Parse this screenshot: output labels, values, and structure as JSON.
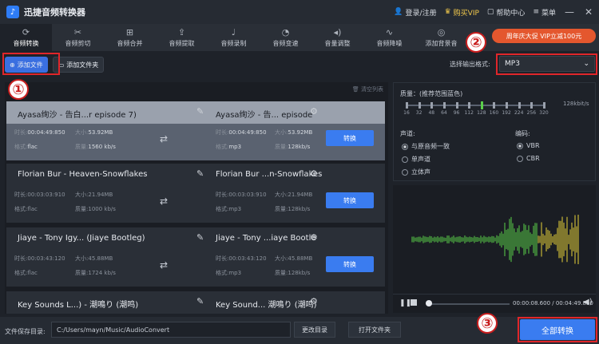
{
  "app": {
    "title": "迅捷音频转换器"
  },
  "titlebar": {
    "login": "登录/注册",
    "vip": "购买VIP",
    "help": "帮助中心",
    "menu": "菜单",
    "minimize": "—",
    "close": "✕"
  },
  "toolbar": {
    "tabs": [
      {
        "label": "音频转换",
        "icon": "refresh-icon"
      },
      {
        "label": "音频剪切",
        "icon": "scissors-icon"
      },
      {
        "label": "音频合并",
        "icon": "merge-icon"
      },
      {
        "label": "音频提取",
        "icon": "extract-icon"
      },
      {
        "label": "音频录制",
        "icon": "microphone-icon"
      },
      {
        "label": "音频变速",
        "icon": "speed-icon"
      },
      {
        "label": "音量调整",
        "icon": "volume-icon"
      },
      {
        "label": "音频降噪",
        "icon": "denoise-icon"
      },
      {
        "label": "添加背景音",
        "icon": "music-icon"
      }
    ],
    "promo": "周年庆大促 VIP立减100元"
  },
  "actions": {
    "add_file": "添加文件",
    "add_folder": "添加文件夹",
    "format_label": "选择输出格式:",
    "format_value": "MP3"
  },
  "annotations": {
    "one": "①",
    "two": "②",
    "three": "③"
  },
  "filelist": {
    "clear": "清空列表",
    "items": [
      {
        "src": "Ayasa绚沙 - 告白...r episode 7)",
        "dst": "Ayasa绚沙 - 告... episode",
        "src_duration": "00:04:49:850",
        "src_size": "53.92MB",
        "src_format": "flac",
        "src_quality": "1560 kb/s",
        "dst_duration": "00:04:49:850",
        "dst_size": "53.92MB",
        "dst_format": "mp3",
        "dst_quality": "128kb/s",
        "button": "转换"
      },
      {
        "src": "Florian Bur - Heaven-Snowflakes",
        "dst": "Florian Bur ...n-Snowflakes",
        "src_duration": "00:03:03:910",
        "src_size": "21.94MB",
        "src_format": "flac",
        "src_quality": "1000 kb/s",
        "dst_duration": "00:03:03:910",
        "dst_size": "21.94MB",
        "dst_format": "mp3",
        "dst_quality": "128kb/s",
        "button": "转换"
      },
      {
        "src": "Jiaye - Tony Igy... (Jiaye Bootleg)",
        "dst": "Jiaye - Tony ...iaye Bootle",
        "src_duration": "00:03:43:120",
        "src_size": "45.88MB",
        "src_format": "flac",
        "src_quality": "1724 kb/s",
        "dst_duration": "00:03:43:120",
        "dst_size": "45.88MB",
        "dst_format": "mp3",
        "dst_quality": "128kb/s",
        "button": "转换"
      },
      {
        "src": "Key Sounds L...) - 潮鳴り (潮鸣)",
        "dst": "Key Sound... 潮鳴り (潮鸣)"
      }
    ],
    "labels": {
      "duration": "时长:",
      "size": "大小:",
      "format": "格式:",
      "quality": "质量:"
    }
  },
  "settings": {
    "quality_title": "质量：(推荐范围蓝色)",
    "bitrates": [
      "16",
      "32",
      "48",
      "64",
      "96",
      "112",
      "128",
      "160",
      "192",
      "224",
      "256",
      "320"
    ],
    "selected_bitrate": "128",
    "bitrate_readout": "128kbit/s",
    "channel_title": "声道:",
    "channels": [
      "与原音频一致",
      "单声道",
      "立体声"
    ],
    "encoding_title": "编码:",
    "encodings": [
      "VBR",
      "CBR"
    ]
  },
  "player": {
    "time": "00:00:08.600 / 00:04:49.850",
    "progress": 0.03
  },
  "bottom": {
    "save_label": "文件保存目录:",
    "path": "C:/Users/mayn/Music/AudioConvert",
    "change_dir": "更改目录",
    "open_folder": "打开文件夹",
    "convert_all": "全部转换"
  },
  "colors": {
    "accent": "#3a7cf0",
    "wave_green": "#5bd14a",
    "wave_yellow": "#e8d23a",
    "annotation_red": "#e0262a"
  }
}
